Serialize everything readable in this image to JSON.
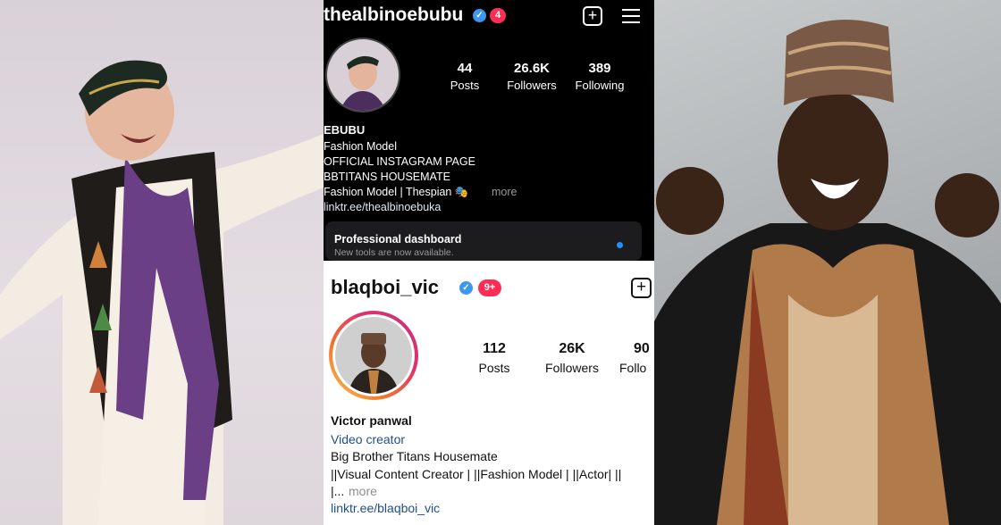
{
  "colors": {
    "ig_blue": "#3b97f0",
    "notif_red": "#ff2d55",
    "link_blue": "#1d4e89",
    "dashboard_dot": "#1e90ff"
  },
  "profile_top": {
    "username": "thealbinoebubu",
    "notifications": "4",
    "stats": [
      {
        "value": "44",
        "label": "Posts"
      },
      {
        "value": "26.6K",
        "label": "Followers"
      },
      {
        "value": "389",
        "label": "Following"
      }
    ],
    "name": "EBUBU",
    "bio_lines": [
      "Fashion Model",
      "OFFICIAL INSTAGRAM PAGE",
      "BBTITANS HOUSEMATE",
      "Fashion Model | Thespian 🎭"
    ],
    "more": "more",
    "link": "linktr.ee/thealbinoebuka",
    "dashboard": {
      "title": "Professional dashboard",
      "subtitle": "New tools are now available."
    }
  },
  "profile_bottom": {
    "username": "blaqboi_vic",
    "notifications": "9+",
    "stats": [
      {
        "value": "112",
        "label": "Posts"
      },
      {
        "value": "26K",
        "label": "Followers"
      },
      {
        "value": "90",
        "label": "Follo"
      }
    ],
    "name": "Victor panwal",
    "category": "Video creator",
    "bio_lines": [
      "Big Brother Titans Housemate",
      "||Visual Content Creator | ||Fashion Model | ||Actor| ||"
    ],
    "ellipsis": "|...",
    "more": "more",
    "link": "linktr.ee/blaqboi_vic"
  }
}
